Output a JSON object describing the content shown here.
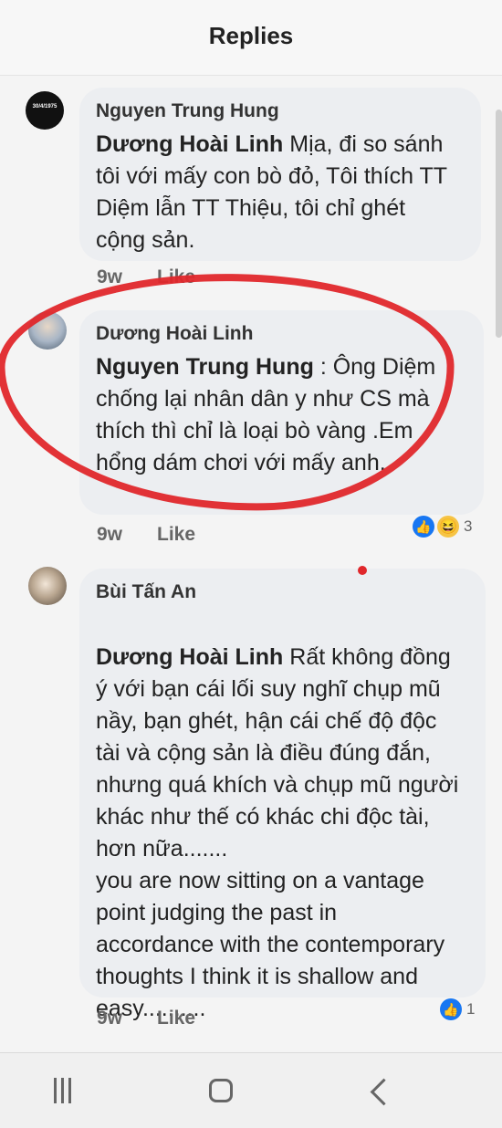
{
  "header": {
    "title": "Replies"
  },
  "comments": [
    {
      "author": "Nguyen Trung Hung",
      "mention": "Dương Hoài Linh",
      "text": " Mịa, đi so sánh tôi với mấy con bò đỏ, Tôi thích TT Diệm lẫn TT Thiệu, tôi chỉ ghét cộng sản.",
      "age": "9w",
      "like": "Like"
    },
    {
      "author": "Dương Hoài Linh",
      "mention": "Nguyen Trung Hung",
      "text": " : Ông Diệm chống lại nhân  dân  y như  CS mà thích thì chỉ  là loại bò vàng .Em hổng dám chơi  với mấy anh.",
      "age": "9w",
      "like": "Like",
      "reactions": {
        "count": "3",
        "icons": [
          "like-icon",
          "haha-icon"
        ]
      }
    },
    {
      "author": "Bùi Tấn An",
      "mention": "Dương Hoài Linh",
      "text": " Rất không đồng ý với bạn cái lối suy nghĩ chụp mũ nầy, bạn ghét, hận cái chế độ độc tài và cộng sản là điều đúng đắn, nhưng quá khích và chụp mũ người khác như thế có khác chi độc tài, hơn nữa.......\nyou are now sitting on a vantage point judging the past in accordance with the contemporary thoughts I think it is shallow and easy..........",
      "age": "9w",
      "like": "Like",
      "reactions": {
        "count": "1",
        "icons": [
          "like-icon"
        ]
      }
    }
  ],
  "avatar_texts": {
    "first": "30/4/1975"
  },
  "colors": {
    "highlight": "#e0272b",
    "like_blue": "#1877f2"
  },
  "nav": {
    "recents": "recents-icon",
    "home": "home-icon",
    "back": "back-icon"
  }
}
